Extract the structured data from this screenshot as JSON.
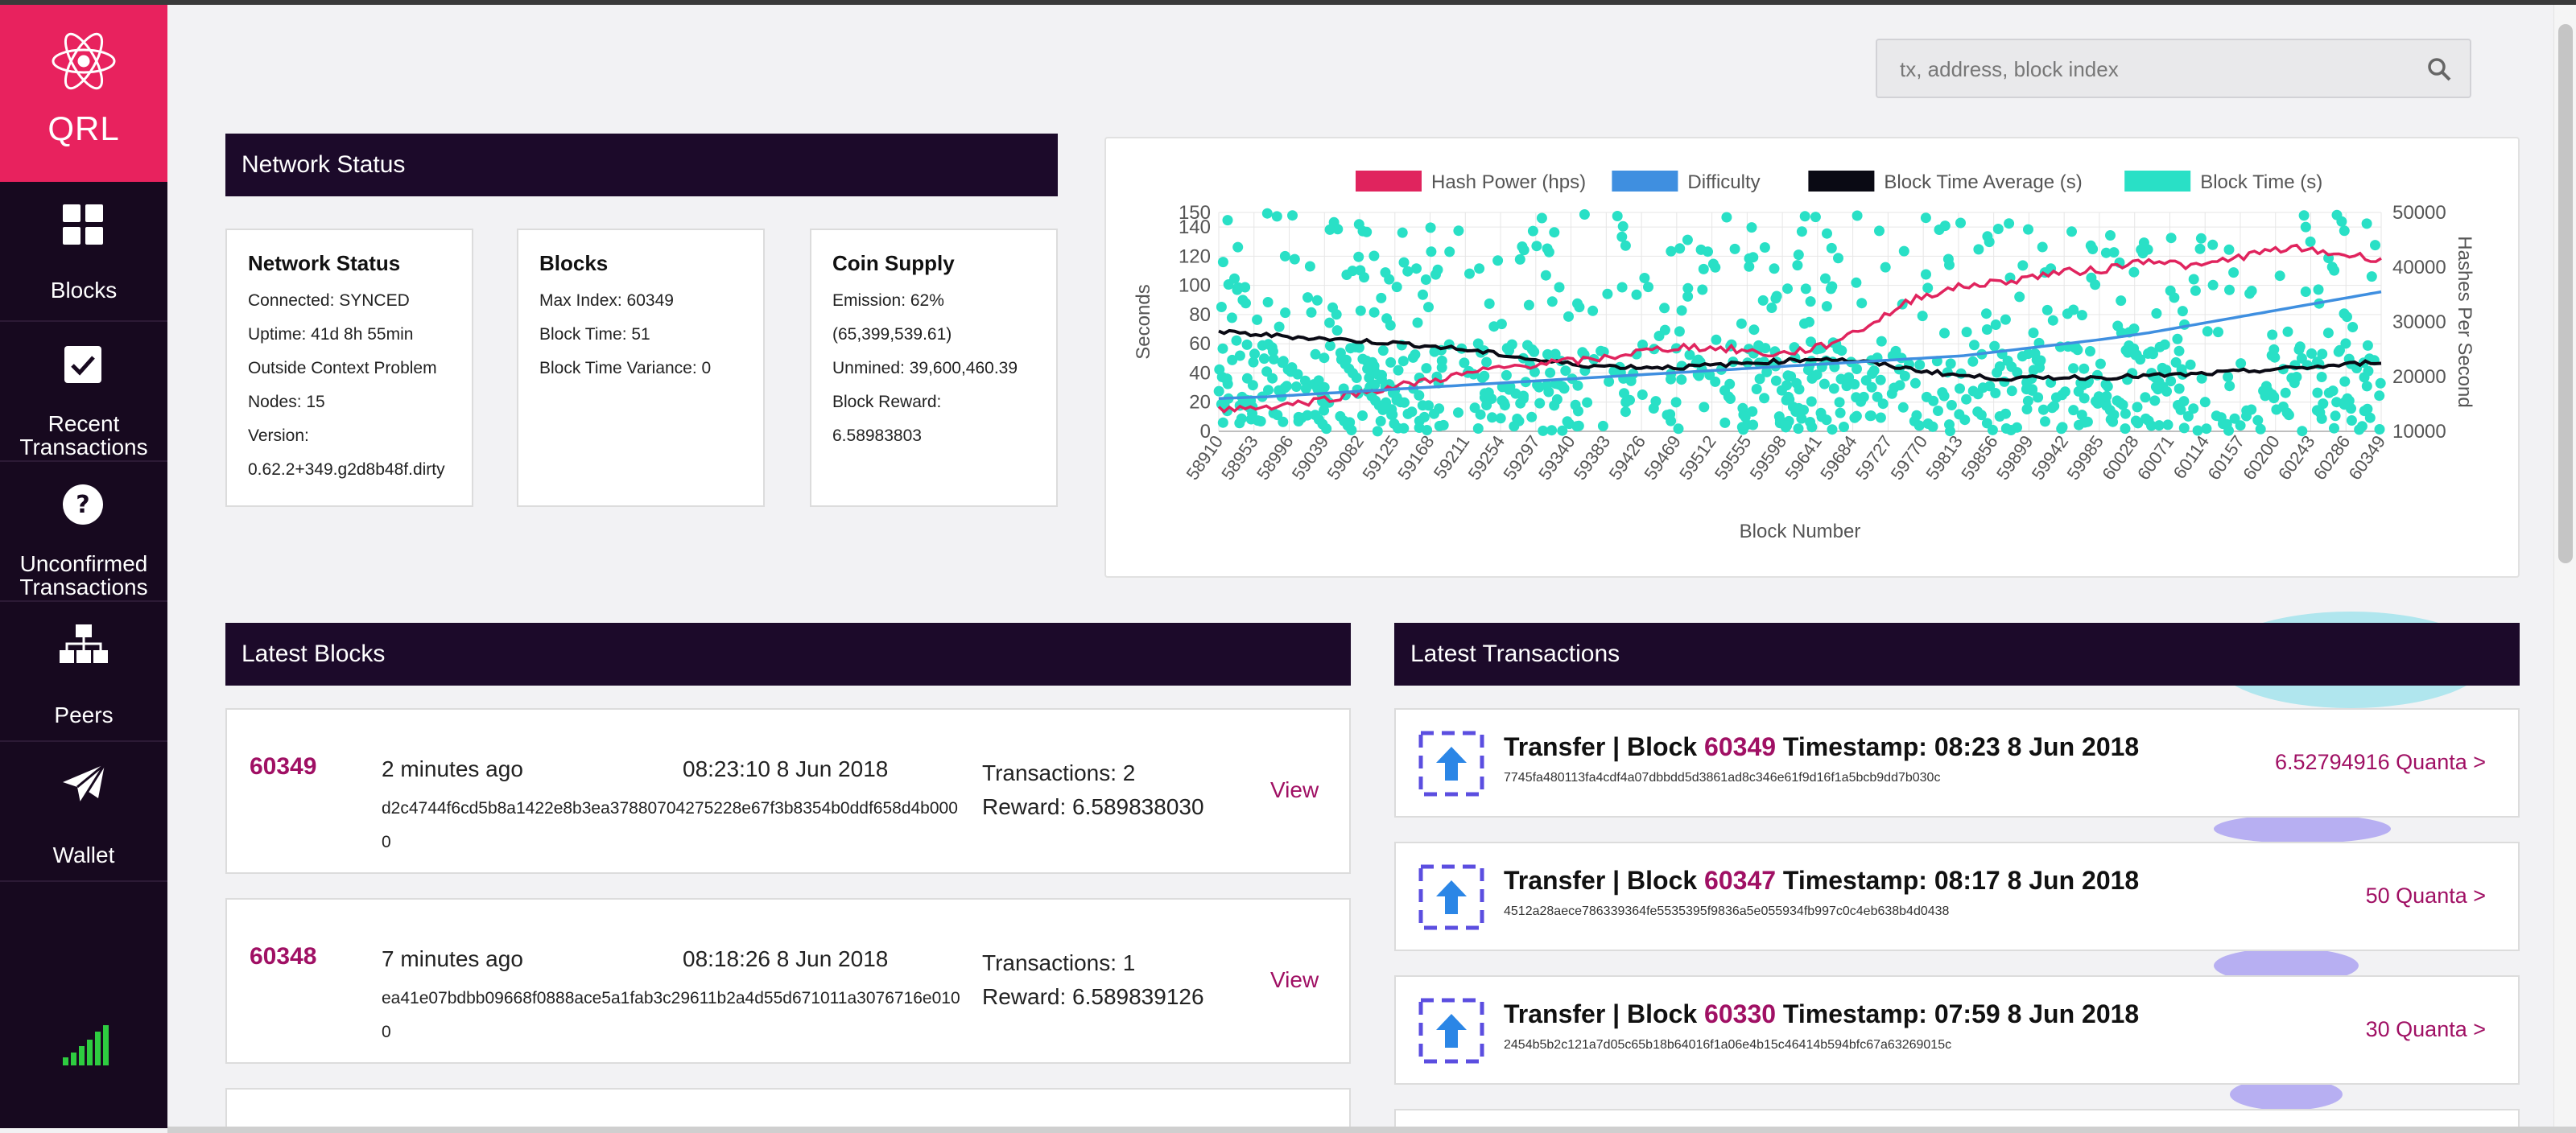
{
  "app": {
    "logo_text": "QRL"
  },
  "sidebar": {
    "items": [
      {
        "label": "Blocks"
      },
      {
        "label": "Recent Transactions"
      },
      {
        "label": "Unconfirmed Transactions"
      },
      {
        "label": "Peers"
      },
      {
        "label": "Wallet"
      }
    ]
  },
  "search": {
    "placeholder": "tx, address, block index"
  },
  "network_status": {
    "header": "Network Status",
    "status_box": {
      "title": "Network Status",
      "lines": [
        "Connected: SYNCED",
        "Uptime: 41d 8h 55min",
        "Outside Context Problem",
        "Nodes: 15",
        "Version:",
        "0.62.2+349.g2d8b48f.dirty"
      ]
    },
    "blocks_box": {
      "title": "Blocks",
      "lines": [
        "Max Index: 60349",
        "Block Time: 51",
        "Block Time Variance: 0"
      ]
    },
    "supply_box": {
      "title": "Coin Supply",
      "lines": [
        "Emission: 62%",
        "(65,399,539.61)",
        "Unmined: 39,600,460.39",
        "Block Reward:",
        "6.58983803"
      ]
    }
  },
  "chart_data": {
    "type": "line",
    "legend": [
      "Hash Power (hps)",
      "Difficulty",
      "Block Time Average (s)",
      "Block Time (s)"
    ],
    "colors": {
      "hash_power": "#e0245e",
      "difficulty": "#3f8fe0",
      "block_time_avg": "#0a0a14",
      "block_time": "#29e0c6"
    },
    "xlabel": "Block Number",
    "ylabel_left": "Seconds",
    "ylabel_right": "Hashes Per Second",
    "ylim_left": [
      0,
      150
    ],
    "ylim_right": [
      10000,
      50000
    ],
    "y_ticks_left": [
      0,
      20,
      40,
      60,
      80,
      100,
      120,
      140,
      150
    ],
    "y_ticks_right": [
      10000,
      20000,
      30000,
      40000,
      50000
    ],
    "x_ticks": [
      "58910",
      "58953",
      "58996",
      "59039",
      "59082",
      "59125",
      "59168",
      "59211",
      "59254",
      "59297",
      "59340",
      "59383",
      "59426",
      "59469",
      "59512",
      "59555",
      "59598",
      "59641",
      "59684",
      "59727",
      "59770",
      "59813",
      "59856",
      "59899",
      "59942",
      "59985",
      "60028",
      "60071",
      "60114",
      "60157",
      "60200",
      "60243",
      "60286",
      "60349"
    ],
    "series": [
      {
        "name": "Hash Power (hps)",
        "axis": "right",
        "values": [
          14000,
          14500,
          15500,
          17000,
          18500,
          20000,
          21500,
          22500,
          23000,
          24500,
          25500,
          25000,
          24000,
          25500,
          29500,
          34500,
          36500,
          37500,
          39000,
          39500,
          41500,
          40000,
          42000,
          43500,
          42500,
          41500
        ]
      },
      {
        "name": "Difficulty",
        "axis": "right",
        "values": [
          16000,
          16300,
          16800,
          17300,
          17800,
          18300,
          18800,
          19300,
          19800,
          20300,
          20800,
          21300,
          21800,
          22300,
          22800,
          23300,
          23800,
          24800,
          25800,
          26800,
          28000,
          29500,
          31000,
          32500,
          34000,
          35500
        ]
      },
      {
        "name": "Block Time Average (s)",
        "axis": "left",
        "values": [
          68,
          66,
          64,
          62,
          60,
          57,
          53,
          48,
          45,
          44,
          44,
          46,
          48,
          50,
          47,
          42,
          38,
          36,
          37,
          37,
          38,
          39,
          41,
          43,
          45,
          48
        ]
      },
      {
        "name": "Block Time (s)",
        "axis": "left",
        "type": "scatter",
        "range": [
          0,
          150
        ]
      }
    ]
  },
  "latest_blocks": {
    "header": "Latest Blocks",
    "view_label": "View",
    "rows": [
      {
        "index": "60349",
        "ago": "2 minutes ago",
        "time": "08:23:10 8 Jun 2018",
        "hash": "d2c4744f6cd5b8a1422e8b3ea37880704275228e67f3b8354b0ddf658d4b0000",
        "tx": "Transactions: 2",
        "reward": "Reward: 6.589838030"
      },
      {
        "index": "60348",
        "ago": "7 minutes ago",
        "time": "08:18:26 8 Jun 2018",
        "hash": "ea41e07bdbb09668f0888ace5a1fab3c29611b2a4d55d671011a3076716e0100",
        "tx": "Transactions: 1",
        "reward": "Reward: 6.589839126"
      }
    ]
  },
  "latest_transactions": {
    "header": "Latest Transactions",
    "rows": [
      {
        "prefix": "Transfer | Block ",
        "block": "60349",
        "ts": " Timestamp: 08:23 8 Jun 2018",
        "hash": "7745fa480113fa4cdf4a07dbbdd5d3861ad8c346e61f9d16f1a5bcb9dd7b030c",
        "amount": "6.52794916 Quanta >"
      },
      {
        "prefix": "Transfer | Block ",
        "block": "60347",
        "ts": " Timestamp: 08:17 8 Jun 2018",
        "hash": "4512a28aece786339364fe5535395f9836a5e055934fb997c0c4eb638b4d0438",
        "amount": "50 Quanta >"
      },
      {
        "prefix": "Transfer | Block ",
        "block": "60330",
        "ts": " Timestamp: 07:59 8 Jun 2018",
        "hash": "2454b5b2c121a7d05c65b18b64016f1a06e4b15c46414b594bfc67a63269015c",
        "amount": "30 Quanta >"
      }
    ]
  }
}
